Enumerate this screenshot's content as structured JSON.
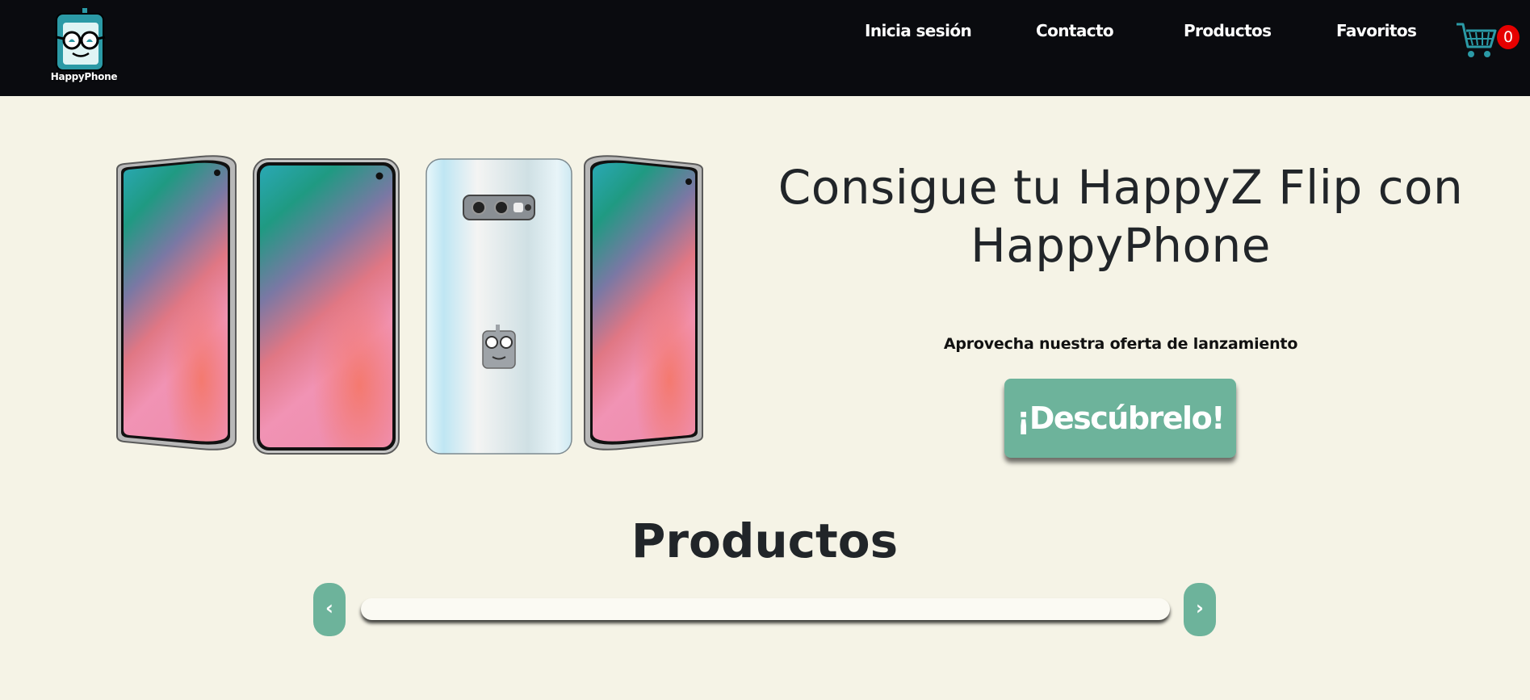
{
  "brand": {
    "name": "HappyPhone",
    "logo_icon": "happyphone-mascot-icon",
    "accent_color": "#6db39b",
    "teal_color": "#2b9aa6",
    "nav_bg": "#0a0b0f",
    "page_bg": "#f5f3e6"
  },
  "nav": {
    "items": [
      {
        "label": "Inicia sesión"
      },
      {
        "label": "Contacto"
      },
      {
        "label": "Productos"
      },
      {
        "label": "Favoritos"
      }
    ],
    "cart_icon": "shopping-cart-icon",
    "cart_count": "0"
  },
  "hero": {
    "image": "phones-product-image",
    "title": "Consigue tu HappyZ Flip con HappyPhone",
    "subtitle": "Aprovecha nuestra oferta de lanzamiento",
    "cta_label": "¡Descúbrelo!"
  },
  "products": {
    "title": "Productos",
    "prev_label": "‹",
    "next_label": "›"
  }
}
